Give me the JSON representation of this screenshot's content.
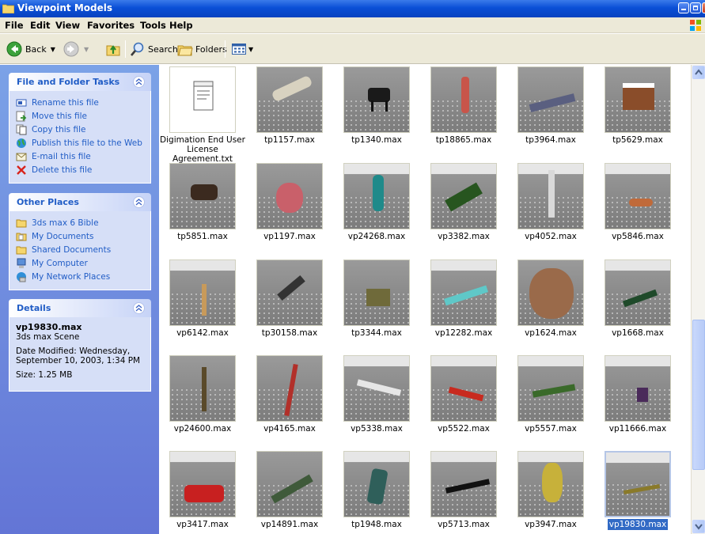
{
  "window": {
    "title": "Viewpoint Models"
  },
  "menu": [
    "File",
    "Edit",
    "View",
    "Favorites",
    "Tools",
    "Help"
  ],
  "toolbar": {
    "back": "Back",
    "search": "Search",
    "folders": "Folders"
  },
  "panels": {
    "tasks": {
      "title": "File and Folder Tasks",
      "items": [
        "Rename this file",
        "Move this file",
        "Copy this file",
        "Publish this file to the Web",
        "E-mail this file",
        "Delete this file"
      ]
    },
    "places": {
      "title": "Other Places",
      "items": [
        "3ds max 6 Bible",
        "My Documents",
        "Shared Documents",
        "My Computer",
        "My Network Places"
      ]
    },
    "details": {
      "title": "Details",
      "name": "vp19830.max",
      "type": "3ds max Scene",
      "date": "Date Modified: Wednesday, September 10, 2003, 1:34 PM",
      "size": "Size: 1.25 MB"
    }
  },
  "files": [
    {
      "name": "Digimation End User License Agreement.txt",
      "kind": "txt"
    },
    {
      "name": "tp1157.max"
    },
    {
      "name": "tp1340.max"
    },
    {
      "name": "tp18865.max"
    },
    {
      "name": "tp3964.max"
    },
    {
      "name": "tp5629.max"
    },
    {
      "name": "tp5851.max"
    },
    {
      "name": "vp1197.max"
    },
    {
      "name": "vp24268.max"
    },
    {
      "name": "vp3382.max"
    },
    {
      "name": "vp4052.max"
    },
    {
      "name": "vp5846.max"
    },
    {
      "name": "vp6142.max"
    },
    {
      "name": "tp30158.max"
    },
    {
      "name": "tp3344.max"
    },
    {
      "name": "vp12282.max"
    },
    {
      "name": "vp1624.max"
    },
    {
      "name": "vp1668.max"
    },
    {
      "name": "vp24600.max"
    },
    {
      "name": "vp4165.max"
    },
    {
      "name": "vp5338.max"
    },
    {
      "name": "vp5522.max"
    },
    {
      "name": "vp5557.max"
    },
    {
      "name": "vp11666.max"
    },
    {
      "name": "vp3417.max"
    },
    {
      "name": "vp14891.max"
    },
    {
      "name": "tp1948.max"
    },
    {
      "name": "vp5713.max"
    },
    {
      "name": "vp3947.max"
    },
    {
      "name": "vp19830.max",
      "selected": true
    }
  ]
}
